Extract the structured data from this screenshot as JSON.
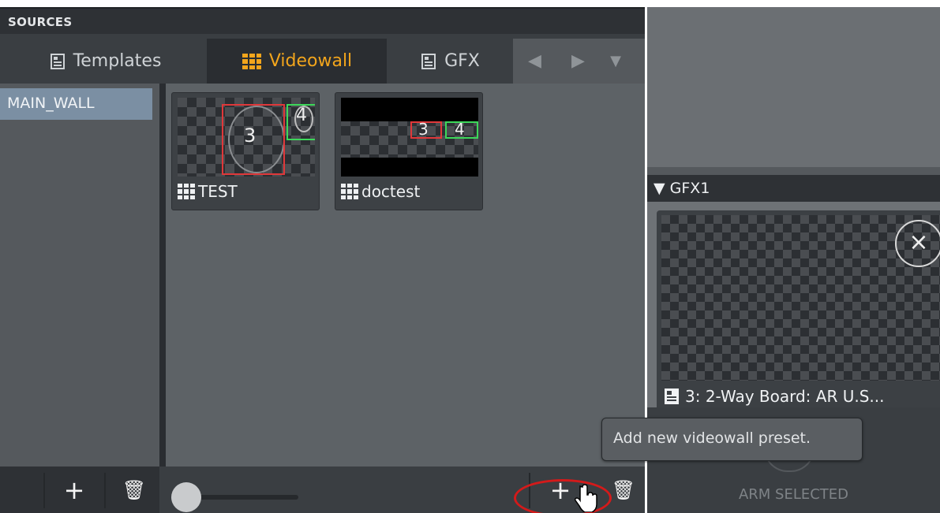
{
  "sources": {
    "title": "SOURCES",
    "tabs": [
      {
        "label": "Templates",
        "icon": "template-icon",
        "active": false
      },
      {
        "label": "Videowall",
        "icon": "videowall-grid-icon",
        "active": true
      },
      {
        "label": "GFX",
        "icon": "template-icon",
        "active": false
      }
    ],
    "nav": {
      "prev": "◀",
      "next": "▶",
      "menu": "▼"
    },
    "list": [
      {
        "label": "MAIN_WALL",
        "selected": true
      }
    ],
    "presets": [
      {
        "name": "TEST",
        "markers": [
          "3",
          "4"
        ]
      },
      {
        "name": "doctest",
        "markers": [
          "3",
          "4"
        ]
      }
    ],
    "bottom": {
      "add": "+",
      "delete": "🗑"
    }
  },
  "gfx": {
    "header": "▼ GFX1",
    "close": "×",
    "item_label": "3: 2-Way Board: AR  U.S...",
    "arm_label": "ARM SELECTED"
  },
  "tooltip": {
    "text": "Add new videowall preset."
  },
  "colors": {
    "accent": "#f2a51c",
    "selection": "#7b8fa3",
    "red_marker": "#e0383a",
    "green_marker": "#3dd85a"
  }
}
